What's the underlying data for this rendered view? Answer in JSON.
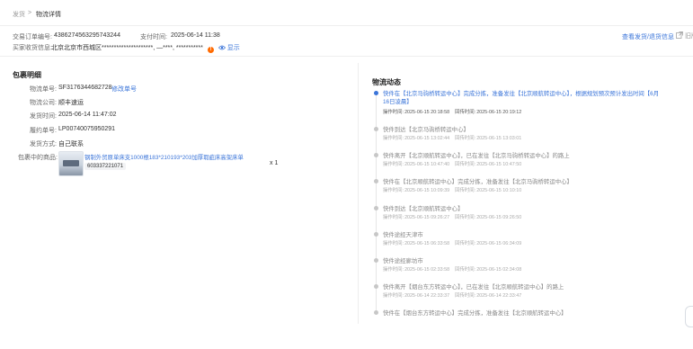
{
  "breadcrumb": {
    "parent": "发货",
    "separator": ">",
    "current": "物流详情"
  },
  "order": {
    "trade_no_label": "交易订单编号:",
    "trade_no": "4386274563295743244",
    "pay_time_label": "支付时间:",
    "pay_time": "2025-06-14 11:38",
    "buyer_label": "买家收货信息:",
    "buyer_info": "北京北京市西城区*********************, —****, ***********",
    "show_label": "显示",
    "view_shipping_link": "查看发货/退货信息",
    "old_version_link": "旧版"
  },
  "package": {
    "title": "包裹明细",
    "rows": [
      {
        "label": "物流单号:",
        "value": "SF3176344682728",
        "action": "修改单号"
      },
      {
        "label": "物流公司:",
        "value": "顺丰速运"
      },
      {
        "label": "发货时间:",
        "value": "2025-06-14 11:47:02"
      },
      {
        "label": "履约单号:",
        "value": "LP00740075950291"
      },
      {
        "label": "发货方式:",
        "value": "自己联系"
      }
    ],
    "goods_label": "包裹中的商品:",
    "goods_name": "钢制外贸原单床支1000根183*210193*203加厚瑕疵床高架床单",
    "goods_sku": "603337221071",
    "goods_qty": "x 1"
  },
  "logistics": {
    "title": "物流动态",
    "op_time_label": "操作时间:",
    "cb_time_label": "回传时间:",
    "events": [
      {
        "line1": "快件在【北京马驹桥转运中心】完成分拣，准备发往【北京顺航转运中心】，根据规划预次预计发出时间【6月",
        "line2": "16日凌晨】",
        "op_time": "2025-06-15 20:18:58",
        "cb_time": "2025-06-15 20:19:12",
        "active": true
      },
      {
        "line1": "快件到达【北京马驹桥转运中心】",
        "op_time": "2025-06-15 13:02:44",
        "cb_time": "2025-06-15 13:03:01",
        "active": false
      },
      {
        "line1": "快件离开【北京顺航转运中心】，已在发往【北京马驹桥转运中心】的路上",
        "op_time": "2025-06-15 10:47:40",
        "cb_time": "2025-06-15 10:47:50",
        "active": false
      },
      {
        "line1": "快件在【北京顺航转运中心】完成分拣，准备发往【北京马驹桥转运中心】",
        "op_time": "2025-06-15 10:09:39",
        "cb_time": "2025-06-15 10:10:10",
        "active": false
      },
      {
        "line1": "快件到达【北京顺航转运中心】",
        "op_time": "2025-06-15 09:26:27",
        "cb_time": "2025-06-15 09:26:50",
        "active": false
      },
      {
        "line1": "快件途经天津市",
        "op_time": "2025-06-15 06:33:58",
        "cb_time": "2025-06-15 06:34:09",
        "active": false
      },
      {
        "line1": "快件途经廊坊市",
        "op_time": "2025-06-15 02:33:58",
        "cb_time": "2025-06-15 02:34:08",
        "active": false
      },
      {
        "line1": "快件离开【烟台东方转运中心】，已在发往【北京顺航转运中心】的路上",
        "op_time": "2025-06-14 22:33:37",
        "cb_time": "2025-06-14 22:33:47",
        "active": false
      },
      {
        "line1": "快件在【烟台东方转运中心】完成分拣，准备发往【北京顺航转运中心】",
        "op_time": "",
        "cb_time": "",
        "active": false
      }
    ]
  },
  "colors": {
    "accent": "#3a74d9",
    "warning": "#ff6a00",
    "text": "#333333",
    "muted": "#999999"
  },
  "icons": [
    "warning-icon",
    "eye-icon",
    "external-link-icon",
    "product-thumbnail"
  ]
}
